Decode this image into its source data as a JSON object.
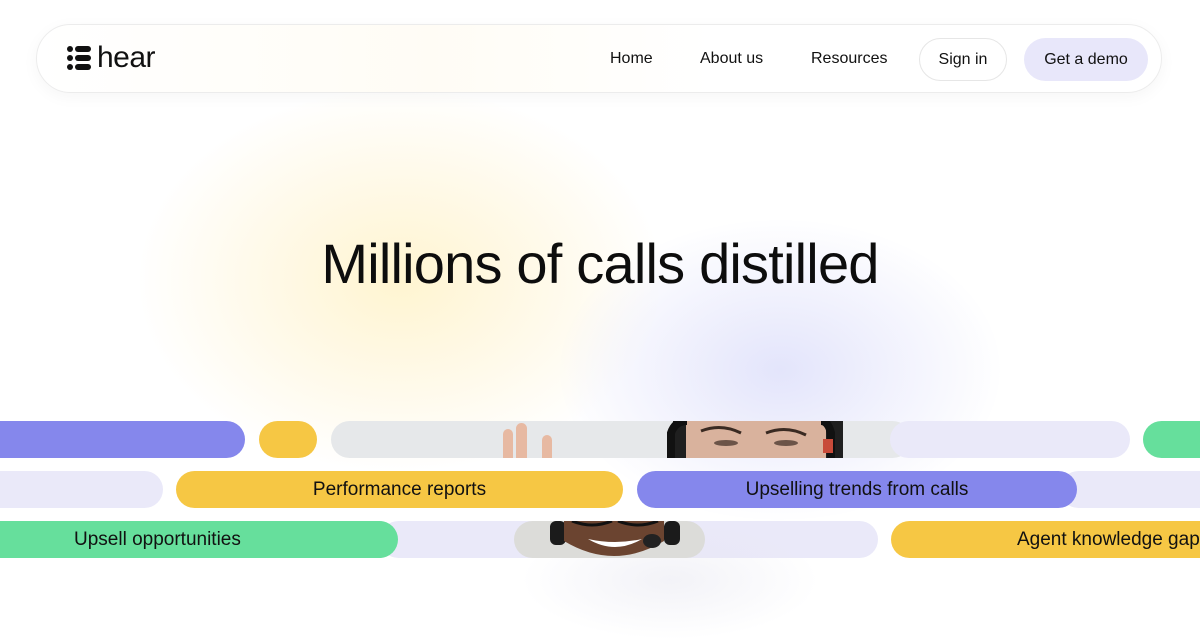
{
  "brand": {
    "name": "hear",
    "logo_icon": "stacked-bars-logo-icon"
  },
  "nav": {
    "links": [
      {
        "label": "Home"
      },
      {
        "label": "About us"
      },
      {
        "label": "Resources"
      }
    ],
    "sign_in_label": "Sign in",
    "demo_label": "Get a demo"
  },
  "hero": {
    "title": "Millions of calls distilled"
  },
  "pills": {
    "row2": [
      "Performance reports",
      "Upselling trends from calls"
    ],
    "row3": [
      "Upsell opportunities",
      "Agent knowledge gap"
    ]
  },
  "colors": {
    "purple": "#8587ec",
    "yellow": "#f6c744",
    "green": "#66df9c",
    "lilac": "#eae9f9",
    "demo_button": "#e8e7fa"
  }
}
